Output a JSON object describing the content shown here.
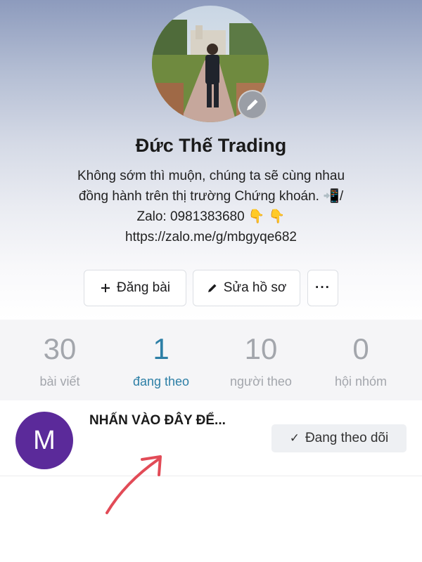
{
  "profile": {
    "name": "Đức Thế Trading",
    "bio_lines": [
      "Không sớm thì muộn, chúng ta sẽ cùng nhau",
      "đồng hành trên thị trường Chứng khoán. 📲/",
      "Zalo: 0981383680 👇 👇",
      "https://zalo.me/g/mbgyqe682"
    ]
  },
  "actions": {
    "post_label": "Đăng bài",
    "edit_label": "Sửa hồ sơ",
    "more_label": "···"
  },
  "stats": [
    {
      "value": "30",
      "label": "bài viết",
      "active": false
    },
    {
      "value": "1",
      "label": "đang theo",
      "active": true
    },
    {
      "value": "10",
      "label": "người theo",
      "active": false
    },
    {
      "value": "0",
      "label": "hội nhóm",
      "active": false
    }
  ],
  "following_item": {
    "avatar_letter": "M",
    "avatar_color": "#5b2a9a",
    "name": "NHẤN VÀO ĐÂY ĐỂ...",
    "follow_label": "Đang theo dõi"
  },
  "colors": {
    "active_tab": "#2d7fa6",
    "annotation_arrow": "#e24b57"
  }
}
